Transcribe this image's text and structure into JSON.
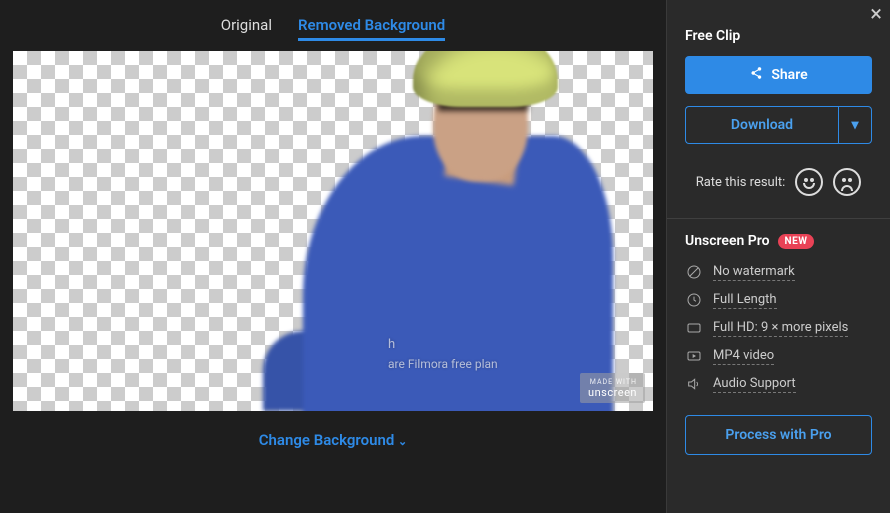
{
  "tabs": {
    "original": "Original",
    "removed": "Removed Background"
  },
  "preview": {
    "overlay_line1": "h",
    "overlay_line2": "are Filmora free plan",
    "watermark_small": "MADE WITH",
    "watermark_brand": "unscreen"
  },
  "change_bg": "Change Background",
  "side": {
    "free_clip": "Free Clip",
    "share": "Share",
    "download": "Download",
    "rate_label": "Rate this result:",
    "pro_title": "Unscreen Pro",
    "new_badge": "NEW",
    "features": {
      "no_watermark": "No watermark",
      "full_length": "Full Length",
      "full_hd": "Full HD: 9 × more pixels",
      "mp4": "MP4 video",
      "audio": "Audio Support"
    },
    "process": "Process with Pro"
  }
}
